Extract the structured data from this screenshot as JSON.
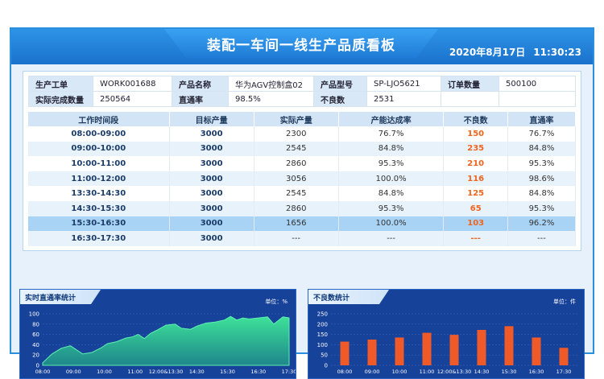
{
  "header": {
    "title": "装配一车间一线生产品质看板",
    "date": "2020年8月17日",
    "time": "11:30:23"
  },
  "info": {
    "row1": [
      {
        "label": "生产工单",
        "value": "WORK001688"
      },
      {
        "label": "产品名称",
        "value": "华为AGV控制盒02"
      },
      {
        "label": "产品型号",
        "value": "SP-LJO5621"
      },
      {
        "label": "订单数量",
        "value": "500100"
      }
    ],
    "row2": [
      {
        "label": "实际完成数量",
        "value": "250564"
      },
      {
        "label": "直通率",
        "value": "98.5%"
      },
      {
        "label": "不良数",
        "value": "2531"
      }
    ]
  },
  "table": {
    "headers": [
      "工作时间段",
      "目标产量",
      "实际产量",
      "产能达成率",
      "不良数",
      "直通率"
    ],
    "rows": [
      [
        "08:00-09:00",
        "3000",
        "2300",
        "76.7%",
        "150",
        "76.7%"
      ],
      [
        "09:00-10:00",
        "3000",
        "2545",
        "84.8%",
        "235",
        "84.8%"
      ],
      [
        "10:00-11:00",
        "3000",
        "2860",
        "95.3%",
        "210",
        "95.3%"
      ],
      [
        "11:00-12:00",
        "3000",
        "3056",
        "100.0%",
        "116",
        "98.6%"
      ],
      [
        "13:30-14:30",
        "3000",
        "2545",
        "84.8%",
        "125",
        "84.8%"
      ],
      [
        "14:30-15:30",
        "3000",
        "2860",
        "95.3%",
        "65",
        "95.3%"
      ],
      [
        "15:30-16:30",
        "3000",
        "1656",
        "100.0%",
        "103",
        "96.2%"
      ],
      [
        "16:30-17:30",
        "3000",
        "---",
        "---",
        "---",
        "---"
      ]
    ],
    "highlight_row": 6
  },
  "colors": {
    "accent": "#2b8fe0",
    "bad": "#f0641e",
    "area_top": "#3ee39a",
    "bar": "#f05a28"
  },
  "chart_data": [
    {
      "type": "area",
      "title": "实时直通率统计",
      "unit": "单位：%",
      "ylim": [
        0,
        100
      ],
      "yticks": [
        0,
        20,
        40,
        60,
        80,
        100
      ],
      "xticks": [
        "08:00",
        "09:00",
        "10:00",
        "11:00",
        "12:00&13:30",
        "14:30",
        "15:30",
        "16:30",
        "17:30"
      ],
      "x": [
        0,
        0.3,
        0.6,
        0.9,
        1.1,
        1.3,
        1.6,
        1.9,
        2.1,
        2.4,
        2.7,
        2.9,
        3.1,
        3.3,
        3.5,
        3.7,
        4.0,
        4.3,
        4.5,
        4.8,
        5.0,
        5.3,
        5.6,
        5.9,
        6.1,
        6.3,
        6.5,
        6.7,
        7.0,
        7.3,
        7.5,
        7.8,
        8.0
      ],
      "values": [
        5,
        22,
        33,
        38,
        30,
        22,
        25,
        34,
        42,
        46,
        53,
        55,
        60,
        52,
        62,
        68,
        78,
        80,
        72,
        70,
        76,
        82,
        84,
        88,
        95,
        88,
        92,
        90,
        92,
        94,
        80,
        94,
        92
      ]
    },
    {
      "type": "bar",
      "title": "不良数统计",
      "unit": "单位：件",
      "ylim": [
        0,
        250
      ],
      "yticks": [
        0,
        50,
        100,
        150,
        200,
        250
      ],
      "categories": [
        "08:00",
        "09:00",
        "10:00",
        "11:00",
        "12:00&13:30",
        "14:30",
        "15:30",
        "16:30",
        "17:30"
      ],
      "values": [
        115,
        125,
        135,
        158,
        148,
        172,
        190,
        135,
        85
      ]
    }
  ]
}
